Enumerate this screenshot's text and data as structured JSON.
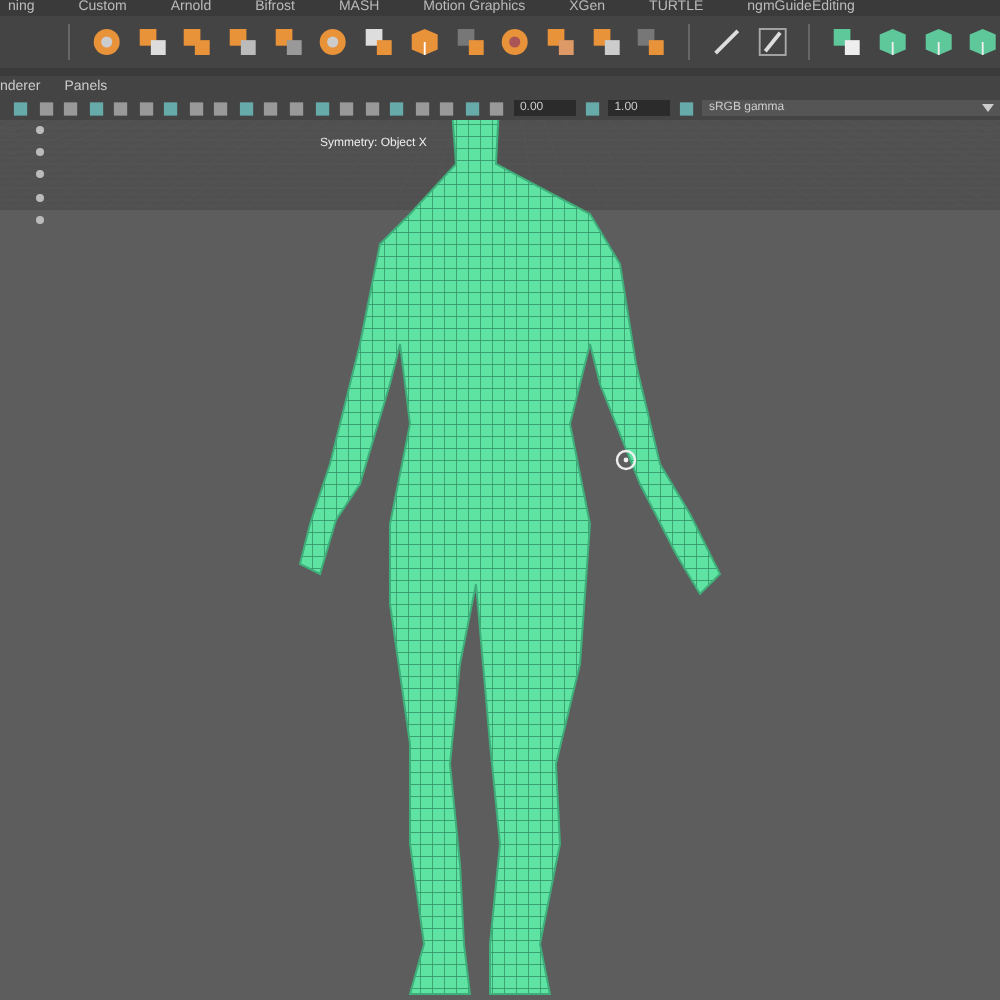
{
  "shelf_tabs": [
    {
      "label": "ning"
    },
    {
      "label": "Custom"
    },
    {
      "label": "Arnold"
    },
    {
      "label": "Bifrost"
    },
    {
      "label": "MASH"
    },
    {
      "label": "Motion Graphics"
    },
    {
      "label": "XGen"
    },
    {
      "label": "TURTLE"
    },
    {
      "label": "ngmGuideEditing"
    }
  ],
  "panel_menu": [
    "nderer",
    "Panels"
  ],
  "panel_toolbar": {
    "fields": [
      "0.00",
      "1.00"
    ],
    "color_space": "sRGB gamma"
  },
  "viewport": {
    "heads_up": "Symmetry: Object X"
  }
}
